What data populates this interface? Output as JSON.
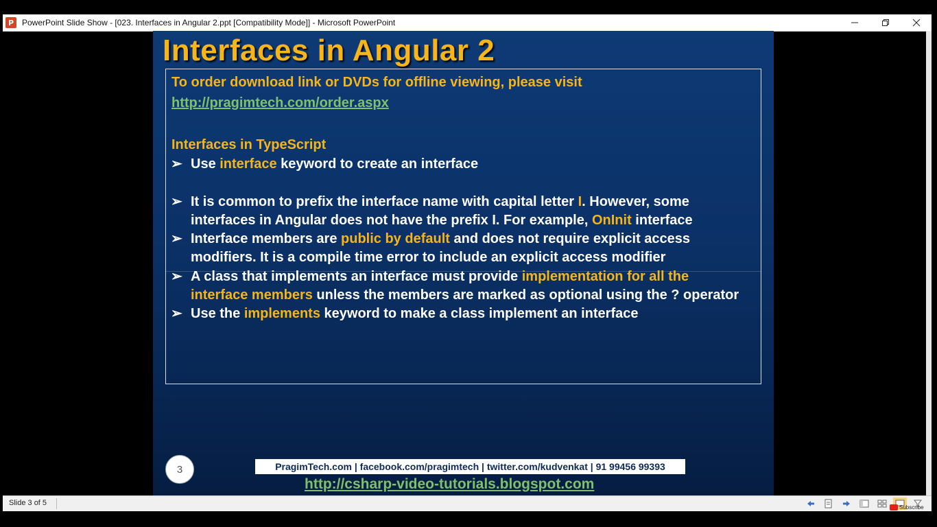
{
  "window": {
    "title": "PowerPoint Slide Show - [023. Interfaces in Angular 2.ppt [Compatibility Mode]] - Microsoft PowerPoint",
    "app_icon_letter": "P"
  },
  "slide": {
    "title": "Interfaces in Angular 2",
    "order_text": "To order download link or DVDs for offline viewing, please visit",
    "order_link": "http://pragimtech.com/order.aspx",
    "section_heading": "Interfaces in TypeScript",
    "bullet_symbol": "➢",
    "bullets": [
      {
        "lines": [
          [
            {
              "text": "Use "
            },
            {
              "text": "interface",
              "highlight": true
            },
            {
              "text": " keyword to create an interface"
            }
          ]
        ]
      },
      {
        "lines": [
          [
            {
              "text": "It is common to prefix the interface name with capital letter "
            },
            {
              "text": "I",
              "highlight": true
            },
            {
              "text": ". However, some"
            }
          ],
          [
            {
              "text": "interfaces in Angular does not have the prefix I. For example, "
            },
            {
              "text": "OnInit",
              "highlight": true
            },
            {
              "text": " interface"
            }
          ]
        ]
      },
      {
        "lines": [
          [
            {
              "text": "Interface members are "
            },
            {
              "text": "public by default",
              "highlight": true
            },
            {
              "text": " and does not require explicit access"
            }
          ],
          [
            {
              "text": "modifiers. It is a compile time error to include an explicit access modifier"
            }
          ]
        ]
      },
      {
        "lines": [
          [
            {
              "text": "A class that implements an interface must provide "
            },
            {
              "text": "implementation for all the",
              "highlight": true
            }
          ],
          [
            {
              "text": "interface members",
              "highlight": true
            },
            {
              "text": " unless the members are marked as optional using the ? operator"
            }
          ]
        ]
      },
      {
        "lines": [
          [
            {
              "text": "Use the "
            },
            {
              "text": "implements",
              "highlight": true
            },
            {
              "text": " keyword to make a class implement an interface"
            }
          ]
        ]
      }
    ],
    "slide_number": "3",
    "footer_contacts": "PragimTech.com | facebook.com/pragimtech  | twitter.com/kudvenkat  | 91 99456 99393",
    "footer_link": "http://csharp-video-tutorials.blogspot.com"
  },
  "statusbar": {
    "slide_info": "Slide 3 of 5"
  },
  "overlay": {
    "subscribe_label": "Subscribe"
  },
  "colors": {
    "title": "#f6b51a",
    "highlight": "#f6b51a",
    "link": "#7dc26a",
    "slide_background": "#0b3167"
  }
}
